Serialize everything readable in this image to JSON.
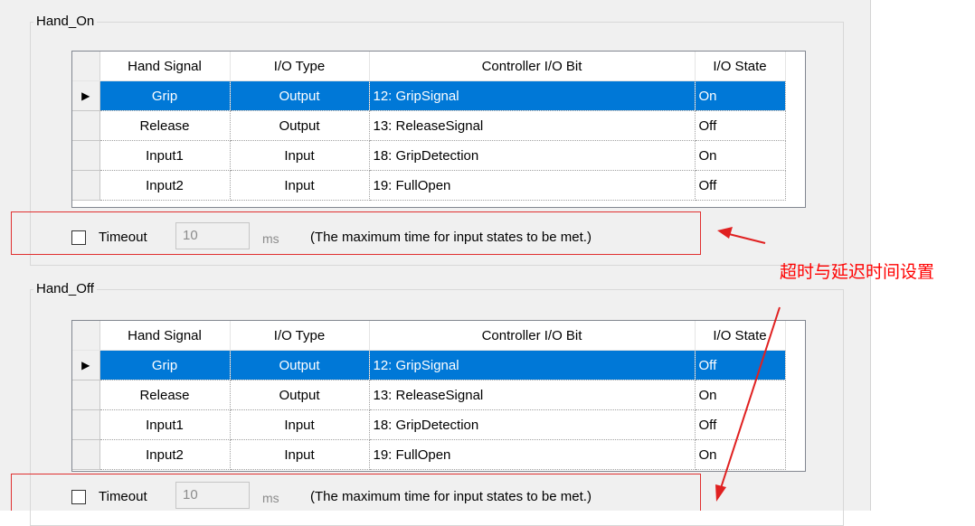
{
  "columns": [
    "Hand Signal",
    "I/O Type",
    "Controller I/O Bit",
    "I/O State"
  ],
  "hand_on": {
    "title": "Hand_On",
    "rows": [
      {
        "signal": "Grip",
        "type": "Output",
        "bit": "12: GripSignal",
        "state": "On"
      },
      {
        "signal": "Release",
        "type": "Output",
        "bit": "13: ReleaseSignal",
        "state": "Off"
      },
      {
        "signal": "Input1",
        "type": "Input",
        "bit": "18: GripDetection",
        "state": "On"
      },
      {
        "signal": "Input2",
        "type": "Input",
        "bit": "19: FullOpen",
        "state": "Off"
      }
    ],
    "current_row_marker": "▶",
    "timeout": {
      "label": "Timeout",
      "value": "10",
      "unit": "ms",
      "description": "(The maximum time for input states to be met.)",
      "checked": false
    }
  },
  "hand_off": {
    "title": "Hand_Off",
    "rows": [
      {
        "signal": "Grip",
        "type": "Output",
        "bit": "12: GripSignal",
        "state": "Off"
      },
      {
        "signal": "Release",
        "type": "Output",
        "bit": "13: ReleaseSignal",
        "state": "On"
      },
      {
        "signal": "Input1",
        "type": "Input",
        "bit": "18: GripDetection",
        "state": "Off"
      },
      {
        "signal": "Input2",
        "type": "Input",
        "bit": "19: FullOpen",
        "state": "On"
      }
    ],
    "current_row_marker": "▶",
    "timeout": {
      "label": "Timeout",
      "value": "10",
      "unit": "ms",
      "description": "(The maximum time for input states to be met.)",
      "checked": false
    }
  },
  "annotation": {
    "text": "超时与延迟时间设置",
    "color": "#ff0000"
  },
  "colors": {
    "selection": "#0078d7",
    "annotation": "#e03030"
  }
}
